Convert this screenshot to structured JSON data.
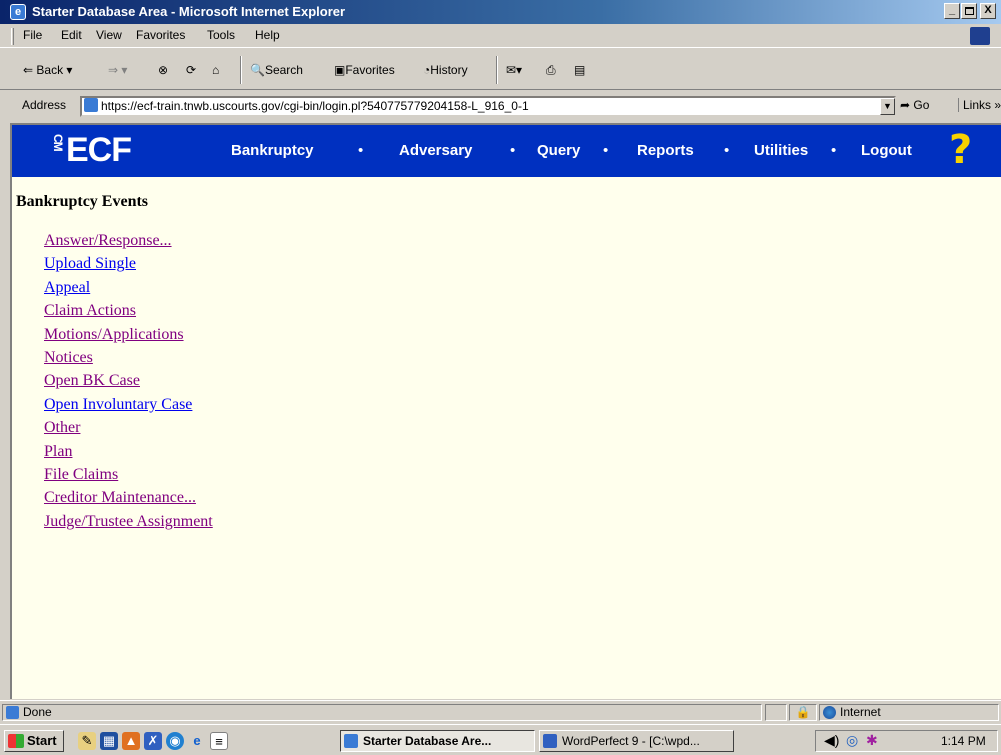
{
  "window": {
    "title": "Starter Database Area - Microsoft Internet Explorer",
    "buttons": [
      "_",
      " ",
      "X"
    ]
  },
  "menu": [
    "File",
    "Edit",
    "View",
    "Favorites",
    "Tools",
    "Help"
  ],
  "toolbar": {
    "back": "Back",
    "search": "Search",
    "favorites": "Favorites",
    "history": "History"
  },
  "address": {
    "label": "Address",
    "url": "https://ecf-train.tnwb.uscourts.gov/cgi-bin/login.pl?540775779204158-L_916_0-1",
    "go": "Go",
    "links": "Links"
  },
  "ecf": {
    "logo": "ECF",
    "logo_prefix": "CM",
    "nav": [
      "Bankruptcy",
      "Adversary",
      "Query",
      "Reports",
      "Utilities",
      "Logout"
    ],
    "help": "?"
  },
  "page": {
    "title": "Bankruptcy Events",
    "events": [
      {
        "label": "Answer/Response...",
        "visited": true
      },
      {
        "label": "Upload Single",
        "visited": false
      },
      {
        "label": "Appeal",
        "visited": false
      },
      {
        "label": "Claim Actions",
        "visited": true
      },
      {
        "label": "Motions/Applications",
        "visited": true
      },
      {
        "label": "Notices",
        "visited": true
      },
      {
        "label": "Open BK Case",
        "visited": true
      },
      {
        "label": "Open Involuntary Case",
        "visited": false
      },
      {
        "label": "Other",
        "visited": true
      },
      {
        "label": "Plan",
        "visited": true
      },
      {
        "label": "File Claims",
        "visited": true
      },
      {
        "label": "Creditor Maintenance...",
        "visited": true
      },
      {
        "label": "Judge/Trustee Assignment",
        "visited": true
      }
    ]
  },
  "status": {
    "text": "Done",
    "zone": "Internet"
  },
  "taskbar": {
    "start": "Start",
    "tasks": [
      {
        "label": "Starter Database Are...",
        "active": true
      },
      {
        "label": "WordPerfect 9 - [C:\\wpd...",
        "active": false
      }
    ],
    "clock": "1:14 PM"
  },
  "colors": {
    "nav_bg": "#0030c0",
    "page_bg": "#ffffed",
    "link": "#0000ee",
    "visited_link": "#800080"
  }
}
